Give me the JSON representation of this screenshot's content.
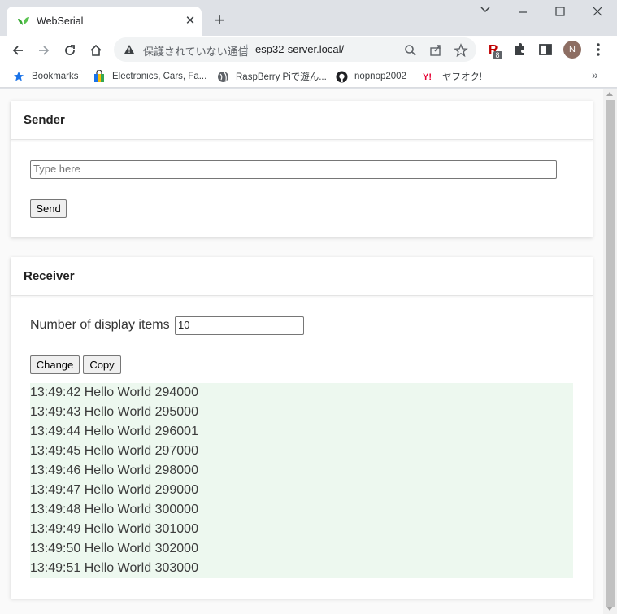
{
  "tab": {
    "title": "WebSerial"
  },
  "omnibox": {
    "security_label": "保護されていない通信",
    "url": "esp32-server.local/"
  },
  "extensions": {
    "badge_count": "8"
  },
  "profile": {
    "initial": "N"
  },
  "bookmarks": [
    {
      "label": "Bookmarks",
      "icon": "star-icon"
    },
    {
      "label": "Electronics, Cars, Fa...",
      "icon": "shopping-bag-icon"
    },
    {
      "label": "RaspBerry Piで遊ん...",
      "icon": "globe-icon"
    },
    {
      "label": "nopnop2002",
      "icon": "github-icon"
    },
    {
      "label": "ヤフオク!",
      "icon": "yahoo-auction-icon"
    }
  ],
  "sender": {
    "title": "Sender",
    "input_placeholder": "Type here",
    "input_value": "",
    "send_label": "Send"
  },
  "receiver": {
    "title": "Receiver",
    "count_label": "Number of display items",
    "count_value": "10",
    "change_label": "Change",
    "copy_label": "Copy",
    "lines": [
      "13:49:42 Hello World 294000",
      "13:49:43 Hello World 295000",
      "13:49:44 Hello World 296001",
      "13:49:45 Hello World 297000",
      "13:49:46 Hello World 298000",
      "13:49:47 Hello World 299000",
      "13:49:48 Hello World 300000",
      "13:49:49 Hello World 301000",
      "13:49:50 Hello World 302000",
      "13:49:51 Hello World 303000"
    ]
  },
  "colors": {
    "log_background": "#edf8ef",
    "tab_strip": "#dee1e6"
  }
}
